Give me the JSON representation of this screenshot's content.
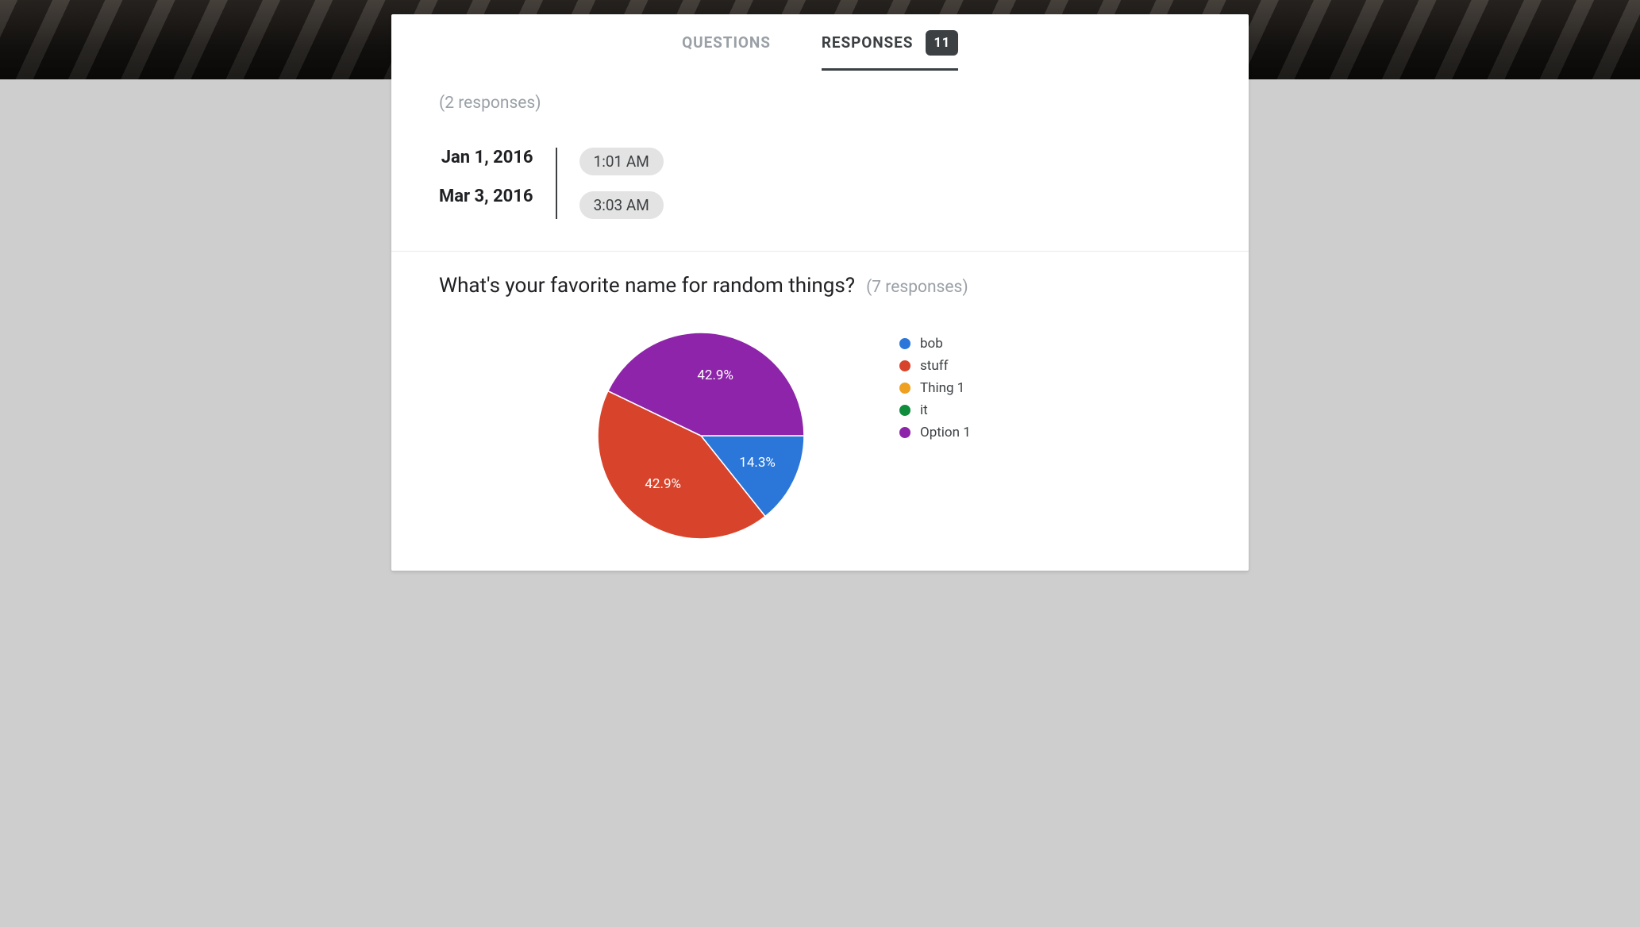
{
  "tabs": {
    "questions": "QUESTIONS",
    "responses": "RESPONSES",
    "badge": "11"
  },
  "section1": {
    "count_label": "(2 responses)",
    "rows": [
      {
        "date": "Jan 1, 2016",
        "time": "1:01 AM"
      },
      {
        "date": "Mar 3, 2016",
        "time": "3:03 AM"
      }
    ]
  },
  "question": {
    "title": "What's your favorite name for random things?",
    "count_label": "(7 responses)"
  },
  "legend": [
    {
      "label": "bob",
      "color": "#2b77d9"
    },
    {
      "label": "stuff",
      "color": "#d8432b"
    },
    {
      "label": "Thing 1",
      "color": "#f0a020"
    },
    {
      "label": "it",
      "color": "#0f8d3c"
    },
    {
      "label": "Option 1",
      "color": "#8e24aa"
    }
  ],
  "chart_data": {
    "type": "pie",
    "title": "What's your favorite name for random things?",
    "series": [
      {
        "name": "bob",
        "value": 14.3,
        "color": "#2b77d9",
        "label": "14.3%"
      },
      {
        "name": "stuff",
        "value": 42.9,
        "color": "#d8432b",
        "label": "42.9%"
      },
      {
        "name": "Thing 1",
        "value": 0,
        "color": "#f0a020",
        "label": ""
      },
      {
        "name": "it",
        "value": 0,
        "color": "#0f8d3c",
        "label": ""
      },
      {
        "name": "Option 1",
        "value": 42.9,
        "color": "#8e24aa",
        "label": "42.9%"
      }
    ]
  }
}
